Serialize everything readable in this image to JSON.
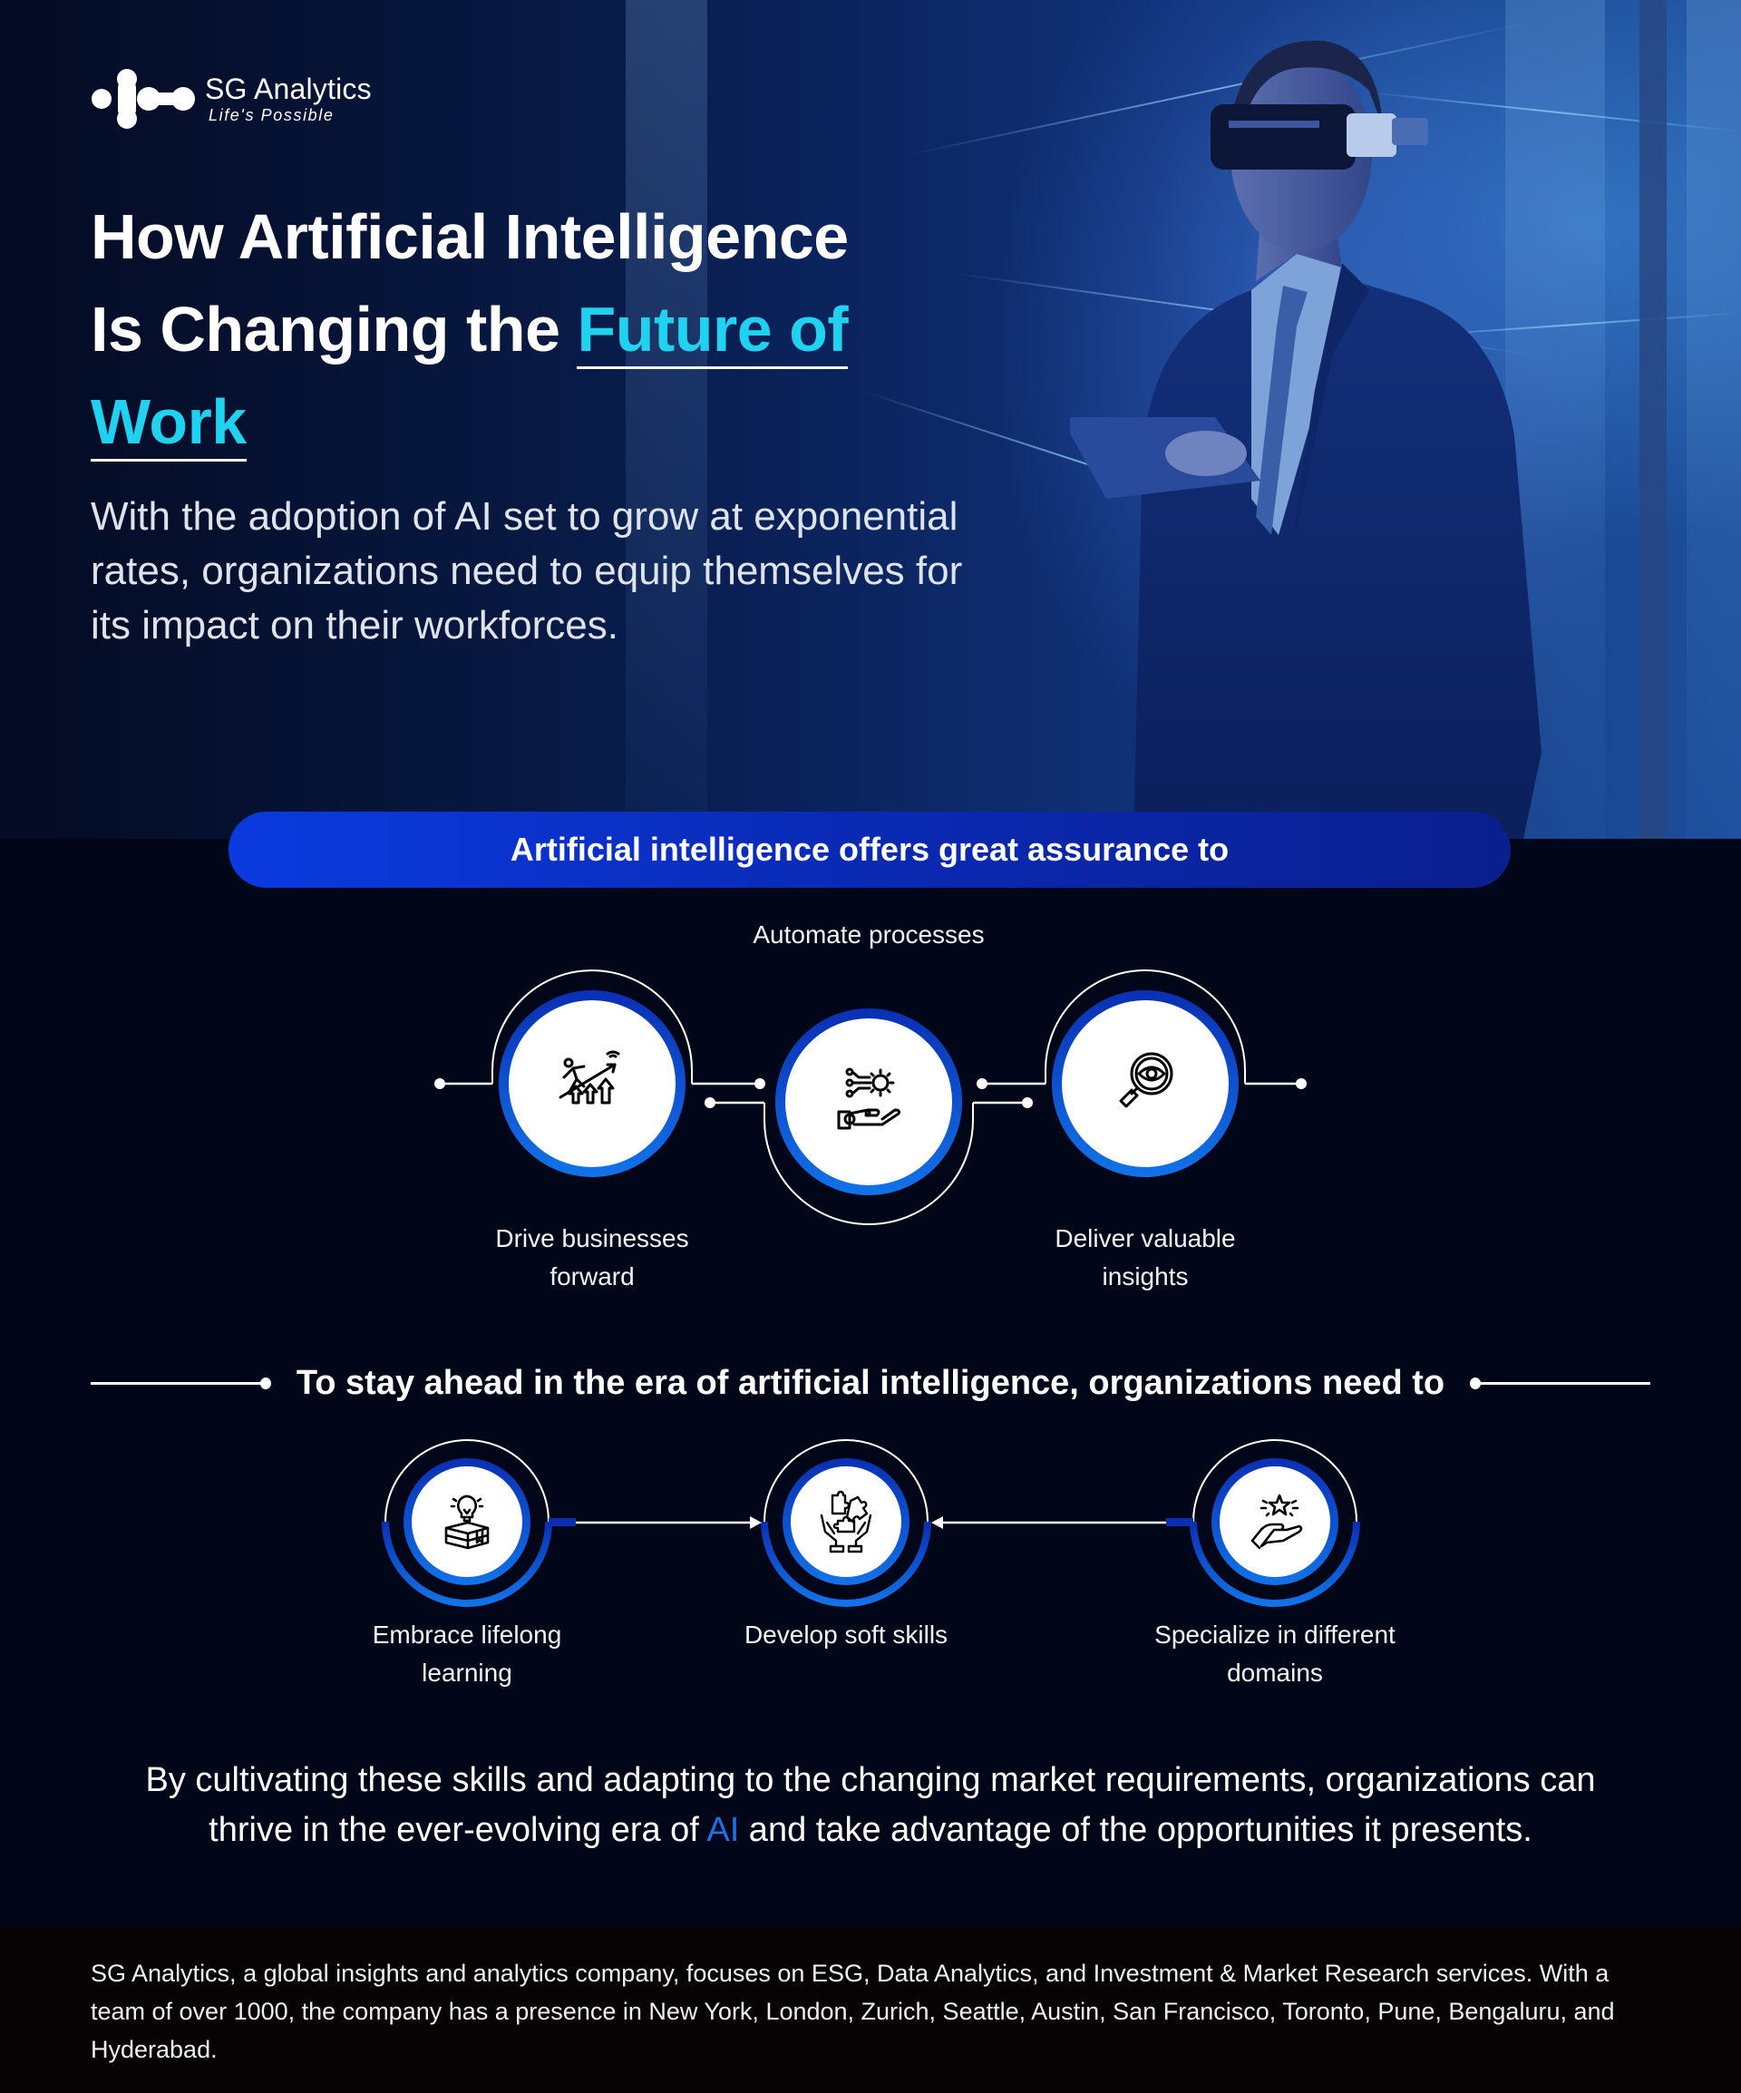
{
  "brand": {
    "name": "SG Analytics",
    "tagline": "Life's Possible"
  },
  "hero": {
    "title_line1": "How Artificial Intelligence",
    "title_line2_prefix": "Is Changing the ",
    "title_accent_line2": "Future of",
    "title_accent_line3": "Work",
    "subtitle": "With the adoption of AI set to grow at exponential rates, organizations need to equip themselves for its impact on their workforces."
  },
  "assurance": {
    "banner": "Artificial intelligence offers great assurance to",
    "items": [
      {
        "label": "Drive businesses forward",
        "icon": "climbing-growth-icon"
      },
      {
        "label": "Automate processes",
        "icon": "robotic-hand-gear-icon"
      },
      {
        "label": "Deliver valuable insights",
        "icon": "magnifier-eye-icon"
      }
    ]
  },
  "needs": {
    "heading": "To stay ahead in the era of artificial intelligence, organizations need to",
    "items": [
      {
        "label": "Embrace lifelong learning",
        "icon": "book-lightbulb-icon"
      },
      {
        "label": "Develop soft skills",
        "icon": "hands-puzzle-icon"
      },
      {
        "label": "Specialize in different domains",
        "icon": "hand-star-icon"
      }
    ]
  },
  "conclusion": {
    "part1": "By cultivating these skills and adapting to the changing market requirements, organizations can thrive in the ever-evolving era of ",
    "highlight": "AI",
    "part2": " and take advantage of the opportunities it presents."
  },
  "footer": {
    "text": "SG Analytics, a global insights and analytics company, focuses on ESG, Data Analytics, and Investment & Market Research services. With a team of over 1000, the company has a presence in New York, London, Zurich, Seattle, Austin, San Francisco, Toronto, Pune, Bengaluru, and Hyderabad."
  },
  "colors": {
    "accent_cyan": "#1fd2f0",
    "accent_blue": "#1f6fe6",
    "banner_blue": "#0a3be0",
    "background": "#020619",
    "footer_bg": "#070203"
  }
}
